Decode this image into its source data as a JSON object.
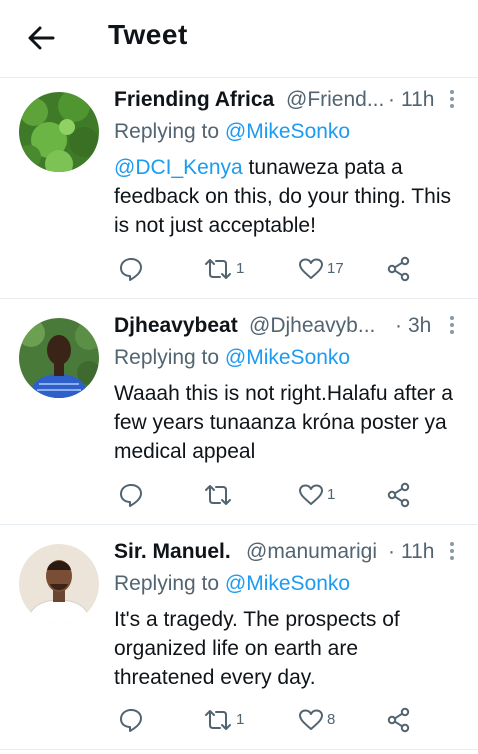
{
  "header": {
    "title": "Tweet"
  },
  "tweets": [
    {
      "name": "Friending Africa",
      "handle": "@Friend...",
      "dot": "·",
      "time": "11h",
      "replying_prefix": "Replying to",
      "replying_to": "@MikeSonko",
      "text_mention": "@DCI_Kenya",
      "text": " tunaweza pata a feedback on this, do your thing. This is not just acceptable!",
      "retweets": "1",
      "likes": "17"
    },
    {
      "name": "Djheavybeat",
      "handle": "@Djheavyb...",
      "dot": "·",
      "time": "3h",
      "replying_prefix": "Replying to",
      "replying_to": "@MikeSonko",
      "text_mention": "",
      "text": "Waaah this is not right.Halafu after a few years tunaanza króna poster ya medical appeal",
      "retweets": "",
      "likes": "1"
    },
    {
      "name": "Sir. Manuel.",
      "handle": "@manumarigi",
      "dot": "·",
      "time": "11h",
      "replying_prefix": "Replying to",
      "replying_to": "@MikeSonko",
      "text_mention": "",
      "text": "It's a tragedy. The prospects of organized life on earth are threatened every day.",
      "retweets": "1",
      "likes": "8"
    }
  ],
  "icons": {
    "back": "arrow-left-icon",
    "more": "more-vertical-icon",
    "reply": "comment-icon",
    "retweet": "retweet-icon",
    "like": "heart-icon",
    "share": "share-icon"
  },
  "colors": {
    "link": "#1d9bf0",
    "secondary": "#536471",
    "icon": "#536471",
    "divider": "#e6ecf0"
  }
}
